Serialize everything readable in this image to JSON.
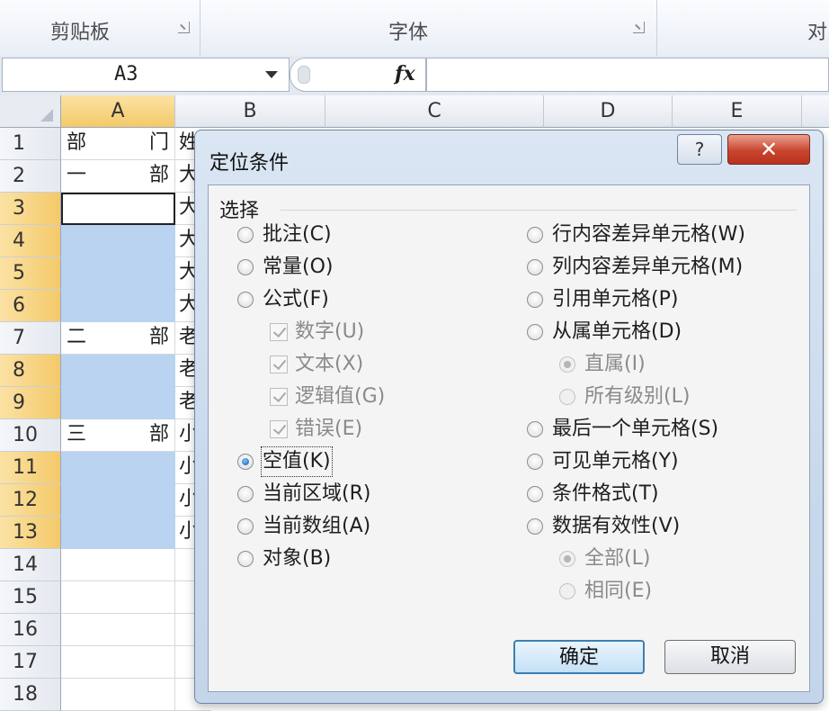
{
  "ribbon": {
    "groups": [
      "剪贴板",
      "字体",
      "对"
    ]
  },
  "formula_bar": {
    "name_box": "A3",
    "fx_label": "fx",
    "formula": ""
  },
  "sheet": {
    "columns": [
      "A",
      "B",
      "C",
      "D",
      "E"
    ],
    "selected_column": "A",
    "rows": [
      {
        "n": "1",
        "a_left": "部",
        "a_right": "门",
        "b": "姓",
        "style": "normal",
        "sel": false
      },
      {
        "n": "2",
        "a_left": "一",
        "a_right": "部",
        "b": "大",
        "style": "normal",
        "sel": false
      },
      {
        "n": "3",
        "a_left": "",
        "a_right": "",
        "b": "大",
        "style": "active",
        "sel": true
      },
      {
        "n": "4",
        "a_left": "",
        "a_right": "",
        "b": "大",
        "style": "blue",
        "sel": true
      },
      {
        "n": "5",
        "a_left": "",
        "a_right": "",
        "b": "大",
        "style": "blue",
        "sel": true
      },
      {
        "n": "6",
        "a_left": "",
        "a_right": "",
        "b": "大",
        "style": "blue",
        "sel": true
      },
      {
        "n": "7",
        "a_left": "二",
        "a_right": "部",
        "b": "老",
        "style": "normal",
        "sel": false
      },
      {
        "n": "8",
        "a_left": "",
        "a_right": "",
        "b": "老",
        "style": "blue",
        "sel": true
      },
      {
        "n": "9",
        "a_left": "",
        "a_right": "",
        "b": "老",
        "style": "blue",
        "sel": true
      },
      {
        "n": "10",
        "a_left": "三",
        "a_right": "部",
        "b": "小",
        "style": "normal",
        "sel": false
      },
      {
        "n": "11",
        "a_left": "",
        "a_right": "",
        "b": "小",
        "style": "blue",
        "sel": true
      },
      {
        "n": "12",
        "a_left": "",
        "a_right": "",
        "b": "小",
        "style": "blue",
        "sel": true
      },
      {
        "n": "13",
        "a_left": "",
        "a_right": "",
        "b": "小",
        "style": "blue",
        "sel": true
      },
      {
        "n": "14",
        "a_left": "",
        "a_right": "",
        "b": "",
        "style": "normal",
        "sel": false
      },
      {
        "n": "15",
        "a_left": "",
        "a_right": "",
        "b": "",
        "style": "normal",
        "sel": false
      },
      {
        "n": "16",
        "a_left": "",
        "a_right": "",
        "b": "",
        "style": "normal",
        "sel": false
      },
      {
        "n": "17",
        "a_left": "",
        "a_right": "",
        "b": "",
        "style": "normal",
        "sel": false
      },
      {
        "n": "18",
        "a_left": "",
        "a_right": "",
        "b": "",
        "style": "normal",
        "sel": false
      }
    ]
  },
  "dialog": {
    "title": "定位条件",
    "help_label": "?",
    "close_label": "✕",
    "group_label": "选择",
    "left_options": [
      {
        "label": "批注(C)",
        "type": "radio",
        "checked": false,
        "disabled": false
      },
      {
        "label": "常量(O)",
        "type": "radio",
        "checked": false,
        "disabled": false
      },
      {
        "label": "公式(F)",
        "type": "radio",
        "checked": false,
        "disabled": false
      },
      {
        "label": "数字(U)",
        "type": "check",
        "checked": true,
        "disabled": true,
        "indent": true
      },
      {
        "label": "文本(X)",
        "type": "check",
        "checked": true,
        "disabled": true,
        "indent": true
      },
      {
        "label": "逻辑值(G)",
        "type": "check",
        "checked": true,
        "disabled": true,
        "indent": true
      },
      {
        "label": "错误(E)",
        "type": "check",
        "checked": true,
        "disabled": true,
        "indent": true
      },
      {
        "label": "空值(K)",
        "type": "radio",
        "checked": true,
        "disabled": false,
        "focus": true
      },
      {
        "label": "当前区域(R)",
        "type": "radio",
        "checked": false,
        "disabled": false
      },
      {
        "label": "当前数组(A)",
        "type": "radio",
        "checked": false,
        "disabled": false
      },
      {
        "label": "对象(B)",
        "type": "radio",
        "checked": false,
        "disabled": false
      }
    ],
    "right_options": [
      {
        "label": "行内容差异单元格(W)",
        "type": "radio",
        "checked": false,
        "disabled": false
      },
      {
        "label": "列内容差异单元格(M)",
        "type": "radio",
        "checked": false,
        "disabled": false
      },
      {
        "label": "引用单元格(P)",
        "type": "radio",
        "checked": false,
        "disabled": false
      },
      {
        "label": "从属单元格(D)",
        "type": "radio",
        "checked": false,
        "disabled": false
      },
      {
        "label": "直属(I)",
        "type": "radio",
        "checked": true,
        "disabled": true,
        "indent": true
      },
      {
        "label": "所有级别(L)",
        "type": "radio",
        "checked": false,
        "disabled": true,
        "indent": true
      },
      {
        "label": "最后一个单元格(S)",
        "type": "radio",
        "checked": false,
        "disabled": false
      },
      {
        "label": "可见单元格(Y)",
        "type": "radio",
        "checked": false,
        "disabled": false
      },
      {
        "label": "条件格式(T)",
        "type": "radio",
        "checked": false,
        "disabled": false
      },
      {
        "label": "数据有效性(V)",
        "type": "radio",
        "checked": false,
        "disabled": false
      },
      {
        "label": "全部(L)",
        "type": "radio",
        "checked": true,
        "disabled": true,
        "indent": true
      },
      {
        "label": "相同(E)",
        "type": "radio",
        "checked": false,
        "disabled": true,
        "indent": true
      }
    ],
    "ok_label": "确定",
    "cancel_label": "取消"
  }
}
